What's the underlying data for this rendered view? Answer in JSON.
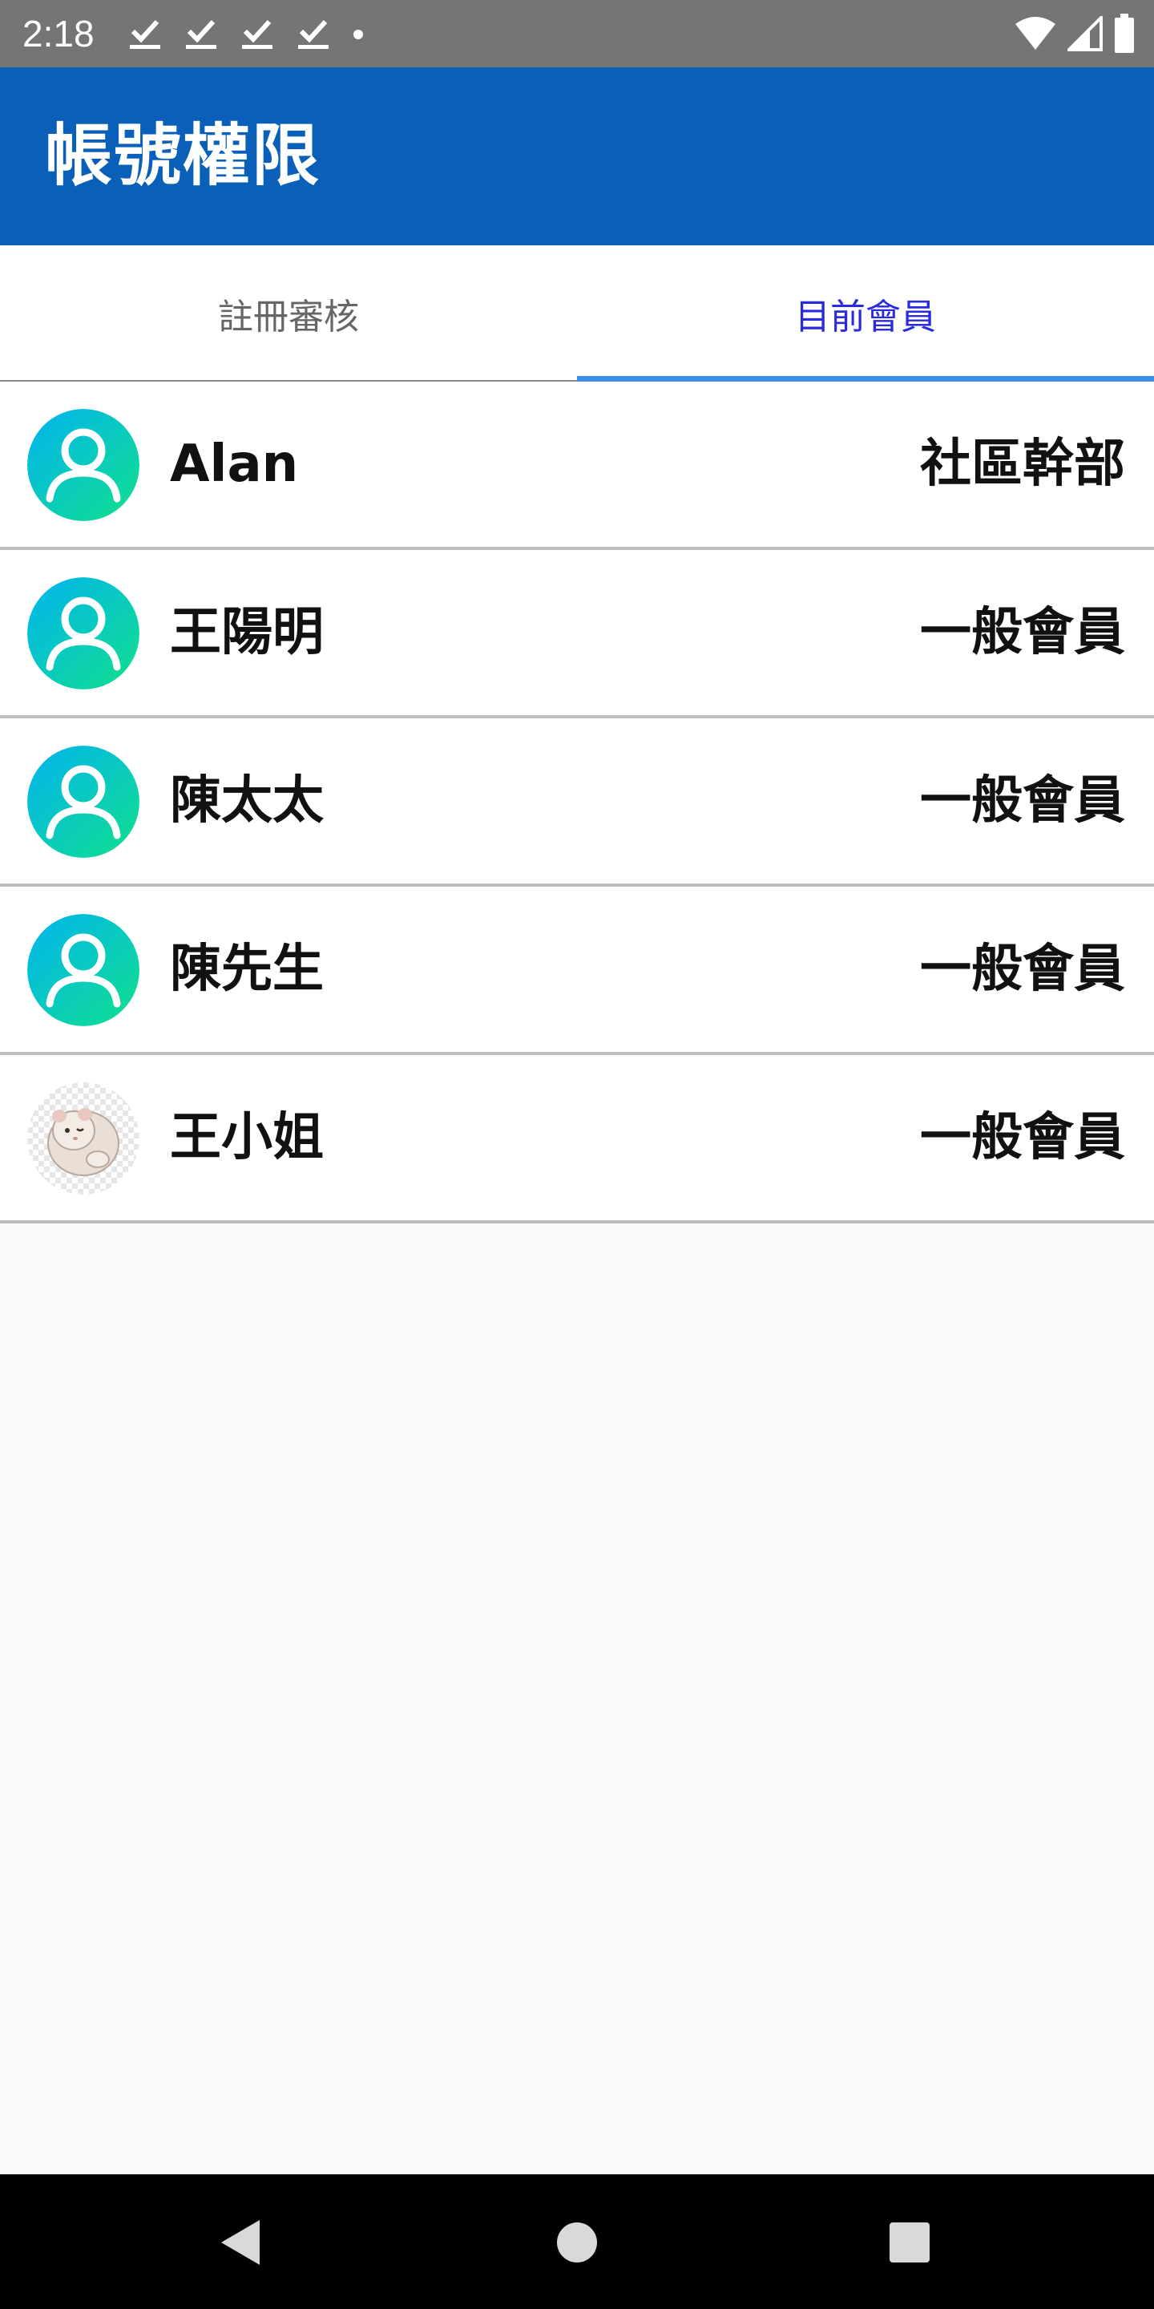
{
  "status_bar": {
    "time": "2:18",
    "left_icons": [
      "check-download-icon",
      "check-download-icon",
      "check-download-icon",
      "check-download-icon",
      "dot-icon"
    ],
    "right_icons": [
      "wifi-icon",
      "cell-signal-icon",
      "battery-icon"
    ]
  },
  "app_bar": {
    "title": "帳號權限",
    "color": "#0a5fb8"
  },
  "tabs": [
    {
      "label": "註冊審核",
      "selected": false
    },
    {
      "label": "目前會員",
      "selected": true
    }
  ],
  "accent_color": "#2a2adf",
  "members": [
    {
      "name": "Alan",
      "role": "社區幹部",
      "avatar": "default-user-icon"
    },
    {
      "name": "王陽明",
      "role": "一般會員",
      "avatar": "default-user-icon"
    },
    {
      "name": "陳太太",
      "role": "一般會員",
      "avatar": "default-user-icon"
    },
    {
      "name": "陳先生",
      "role": "一般會員",
      "avatar": "default-user-icon"
    },
    {
      "name": "王小姐",
      "role": "一般會員",
      "avatar": "hamster-photo"
    }
  ],
  "nav_bar": {
    "buttons": [
      "back-icon",
      "home-icon",
      "recents-icon"
    ]
  }
}
